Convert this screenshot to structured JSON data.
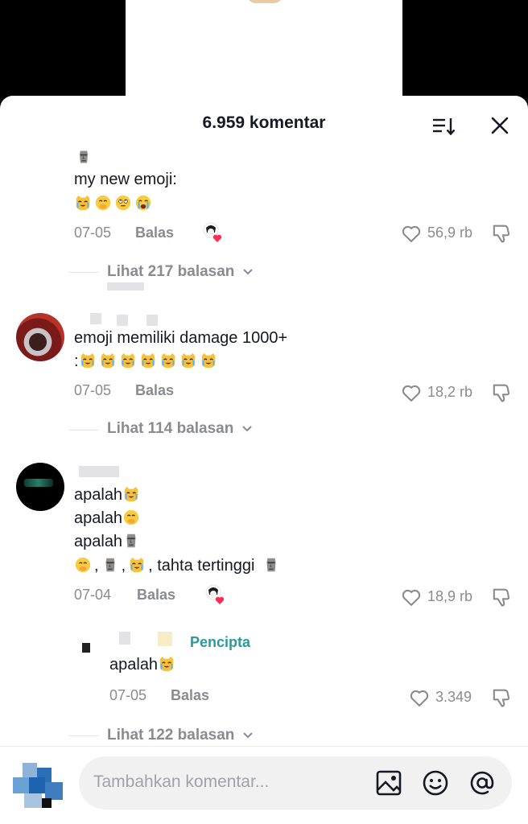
{
  "header": {
    "title": "6.959 komentar"
  },
  "comments": [
    {
      "lines": [
        "my new emoji:"
      ],
      "emoji_line": [
        "crying-cat",
        "smile-hand",
        "eyeroll",
        "crying"
      ],
      "date": "07-05",
      "reply_label": "Balas",
      "likes": "56,9 rb",
      "creator_liked": true,
      "view_replies": "Lihat 217 balasan"
    },
    {
      "lines": [
        "emoji memiliki damage 1000+"
      ],
      "emoji_prefix": ":",
      "emoji_line": [
        "crying-cat",
        "crying-cat",
        "crying-cat",
        "crying-cat",
        "crying-cat",
        "crying-cat",
        "crying-cat"
      ],
      "date": "07-05",
      "reply_label": "Balas",
      "likes": "18,2 rb",
      "creator_liked": false,
      "view_replies": "Lihat 114 balasan"
    },
    {
      "lines": [
        "apalah",
        "apalah",
        "apalah"
      ],
      "last_line_text": ", tahta tertinggi ",
      "date": "07-04",
      "reply_label": "Balas",
      "likes": "18,9 rb",
      "creator_liked": true
    }
  ],
  "reply": {
    "badge": "Pencipta",
    "text": "apalah",
    "date": "07-05",
    "reply_label": "Balas",
    "likes": "3.349",
    "view_replies": "Lihat 122 balasan"
  },
  "footer": {
    "placeholder": "Tambahkan komentar..."
  },
  "colors": {
    "like_heart": "#fe2c55",
    "creator_badge": "#2a9aa0",
    "muted_text": "#8a8b91"
  },
  "icons": [
    "sort-icon",
    "close-icon",
    "heart-outline-icon",
    "thumbs-down-icon",
    "image-icon",
    "emoji-icon",
    "mention-icon"
  ]
}
